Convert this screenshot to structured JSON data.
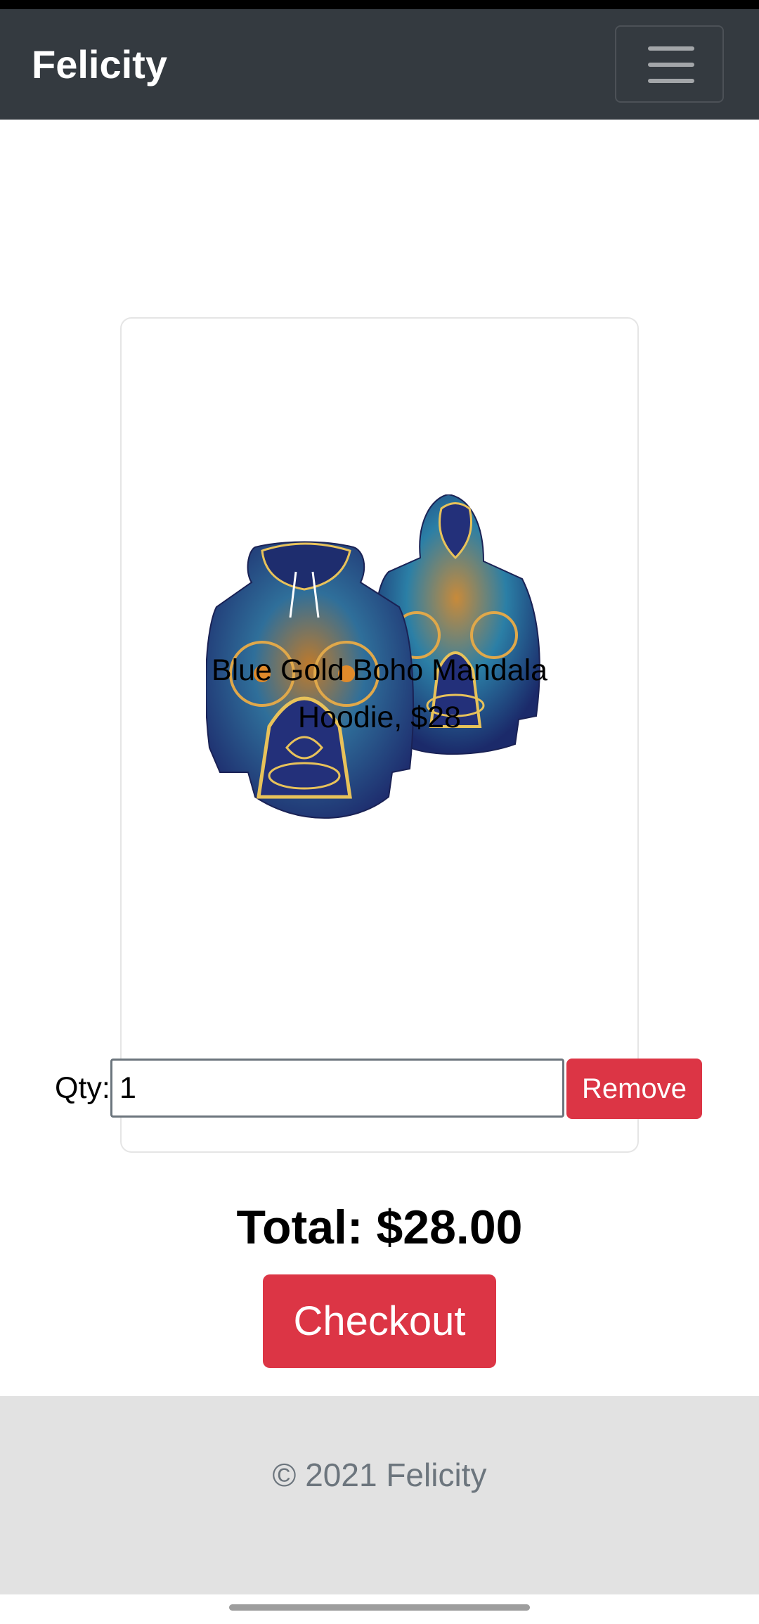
{
  "navbar": {
    "brand": "Felicity",
    "menu_icon": "hamburger-menu-icon"
  },
  "cart": {
    "items": [
      {
        "name": "Blue Gold Boho Mandala Hoodie, $28",
        "image": "blue-gold-mandala-hoodie-image",
        "qty_label": "Qty:",
        "qty_value": "1",
        "remove_label": "Remove"
      }
    ],
    "total_label": "Total: $28.00",
    "checkout_label": "Checkout"
  },
  "footer": {
    "text": "© 2021 Felicity"
  },
  "colors": {
    "navbar_bg": "#343a40",
    "danger": "#dc3545",
    "footer_bg": "#e2e2e2",
    "footer_text": "#6c757d"
  }
}
